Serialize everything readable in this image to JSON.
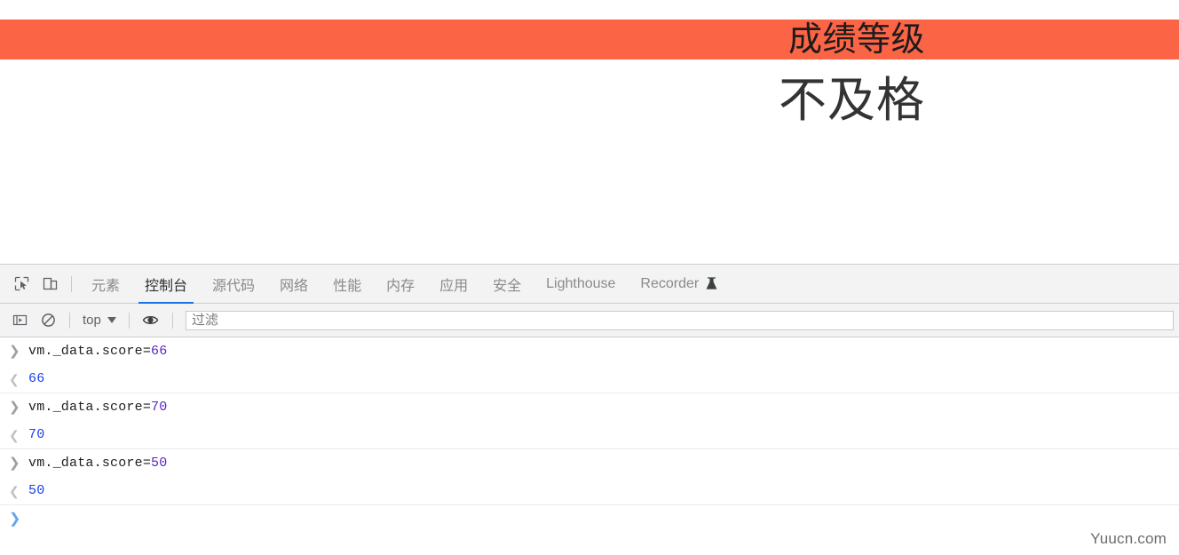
{
  "page": {
    "banner": {
      "title": "成绩等级",
      "background_color": "#fc6446"
    },
    "result_text": "不及格"
  },
  "devtools": {
    "icons": {
      "inspect": "inspect-element-icon",
      "device": "device-toolbar-icon"
    },
    "tabs": [
      {
        "label": "元素",
        "active": false
      },
      {
        "label": "控制台",
        "active": true
      },
      {
        "label": "源代码",
        "active": false
      },
      {
        "label": "网络",
        "active": false
      },
      {
        "label": "性能",
        "active": false
      },
      {
        "label": "内存",
        "active": false
      },
      {
        "label": "应用",
        "active": false
      },
      {
        "label": "安全",
        "active": false
      },
      {
        "label": "Lighthouse",
        "active": false
      },
      {
        "label": "Recorder",
        "active": false,
        "badge_icon": "flask-icon"
      }
    ],
    "active_tab_underline_color": "#1a73e8",
    "console_toolbar": {
      "sidebar_toggle_icon": "console-sidebar-icon",
      "clear_icon": "clear-console-icon",
      "context": "top",
      "eye_icon": "live-expression-eye-icon",
      "filter_placeholder": "过滤",
      "filter_value": ""
    },
    "console_entries": [
      {
        "type": "input",
        "expression": "vm._data.score=",
        "value": "66"
      },
      {
        "type": "output",
        "result": "66"
      },
      {
        "type": "input",
        "expression": "vm._data.score=",
        "value": "70"
      },
      {
        "type": "output",
        "result": "70"
      },
      {
        "type": "input",
        "expression": "vm._data.score=",
        "value": "50"
      },
      {
        "type": "output",
        "result": "50"
      }
    ],
    "prompt_symbol": "❯",
    "input_arrow": "❯",
    "output_arrow": "❮"
  },
  "watermark": "Yuucn.com"
}
